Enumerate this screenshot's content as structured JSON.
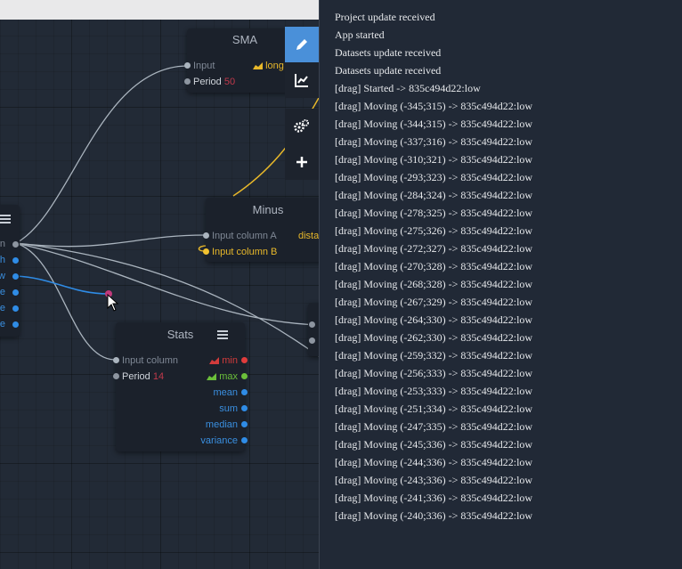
{
  "colors": {
    "accent": "#4a90d9",
    "red_port": "#e03c3c",
    "green_port": "#6bbf3a",
    "blue_port": "#2f8ce6",
    "wire": "#b8c2cc",
    "yellow_port": "#f2c230"
  },
  "nodes": {
    "sma": {
      "title": "SMA",
      "input_label": "Input",
      "output_label": "long",
      "period_label": "Period",
      "period_value": "50"
    },
    "minus": {
      "title": "Minus",
      "input_a_label": "Input column A",
      "input_b_label": "Input column B",
      "output_label": "dista"
    },
    "stats": {
      "title": "Stats",
      "input_label": "Input column",
      "period_label": "Period",
      "period_value": "14",
      "outputs": {
        "min": "min",
        "max": "max",
        "mean": "mean",
        "sum": "sum",
        "median": "median",
        "variance": "variance"
      }
    },
    "source": {
      "ports": [
        "en",
        "gh",
        "ow",
        "se",
        "me",
        "te"
      ]
    }
  },
  "toolbar": {
    "items": [
      "pen-icon",
      "chart-icon",
      "gears-icon",
      "plus-icon"
    ]
  },
  "log": {
    "lines": [
      "Project update received",
      "App started",
      "Datasets update received",
      "Datasets update received",
      "[drag] Started -> 835c494d22:low",
      "[drag] Moving (-345;315) -> 835c494d22:low",
      "[drag] Moving (-344;315) -> 835c494d22:low",
      "[drag] Moving (-337;316) -> 835c494d22:low",
      "[drag] Moving (-310;321) -> 835c494d22:low",
      "[drag] Moving (-293;323) -> 835c494d22:low",
      "[drag] Moving (-284;324) -> 835c494d22:low",
      "[drag] Moving (-278;325) -> 835c494d22:low",
      "[drag] Moving (-275;326) -> 835c494d22:low",
      "[drag] Moving (-272;327) -> 835c494d22:low",
      "[drag] Moving (-270;328) -> 835c494d22:low",
      "[drag] Moving (-268;328) -> 835c494d22:low",
      "[drag] Moving (-267;329) -> 835c494d22:low",
      "[drag] Moving (-264;330) -> 835c494d22:low",
      "[drag] Moving (-262;330) -> 835c494d22:low",
      "[drag] Moving (-259;332) -> 835c494d22:low",
      "[drag] Moving (-256;333) -> 835c494d22:low",
      "[drag] Moving (-253;333) -> 835c494d22:low",
      "[drag] Moving (-251;334) -> 835c494d22:low",
      "[drag] Moving (-247;335) -> 835c494d22:low",
      "[drag] Moving (-245;336) -> 835c494d22:low",
      "[drag] Moving (-244;336) -> 835c494d22:low",
      "[drag] Moving (-243;336) -> 835c494d22:low",
      "[drag] Moving (-241;336) -> 835c494d22:low",
      "[drag] Moving (-240;336) -> 835c494d22:low"
    ]
  }
}
